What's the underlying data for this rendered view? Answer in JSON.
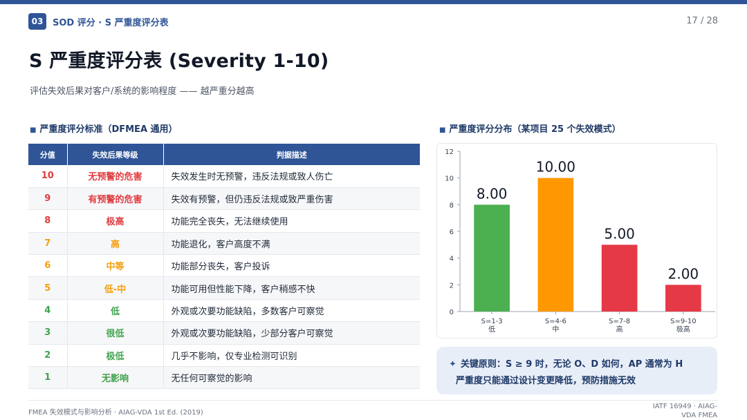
{
  "header": {
    "section_no": "03",
    "section_title": "SOD 评分 · S 严重度评分表",
    "page_indicator": "17 / 28"
  },
  "title": "S 严重度评分表 (Severity 1-10)",
  "subtitle": "评估失效后果对客户/系统的影响程度 —— 越严重分越高",
  "left_panel": {
    "title": "严重度评分标准（DFMEA 通用）",
    "columns": [
      "分值",
      "失效后果等级",
      "判据描述"
    ],
    "rows": [
      {
        "score": "10",
        "level": "无预警的危害",
        "desc": "失效发生时无预警，违反法规或致人伤亡",
        "color": "#e03a3e"
      },
      {
        "score": "9",
        "level": "有预警的危害",
        "desc": "失效有预警，但仍违反法规或致严重伤害",
        "color": "#e03a3e"
      },
      {
        "score": "8",
        "level": "极高",
        "desc": "功能完全丧失，无法继续使用",
        "color": "#e03a3e"
      },
      {
        "score": "7",
        "level": "高",
        "desc": "功能退化，客户高度不满",
        "color": "#f59e0b"
      },
      {
        "score": "6",
        "level": "中等",
        "desc": "功能部分丧失，客户投诉",
        "color": "#f59e0b"
      },
      {
        "score": "5",
        "level": "低-中",
        "desc": "功能可用但性能下降，客户稍感不快",
        "color": "#f59e0b"
      },
      {
        "score": "4",
        "level": "低",
        "desc": "外观或次要功能缺陷，多数客户可察觉",
        "color": "#3fa34d"
      },
      {
        "score": "3",
        "level": "很低",
        "desc": "外观或次要功能缺陷，少部分客户可察觉",
        "color": "#3fa34d"
      },
      {
        "score": "2",
        "level": "极低",
        "desc": "几乎不影响，仅专业检测可识别",
        "color": "#3fa34d"
      },
      {
        "score": "1",
        "level": "无影响",
        "desc": "无任何可察觉的影响",
        "color": "#3fa34d"
      }
    ]
  },
  "right_panel": {
    "title": "严重度评分分布（某项目 25 个失效模式）"
  },
  "chart_data": {
    "type": "bar",
    "categories": [
      "S=1-3\n低",
      "S=4-6\n中",
      "S=7-8\n高",
      "S=9-10\n极高"
    ],
    "values": [
      8,
      10,
      5,
      2
    ],
    "data_labels": [
      "8.00",
      "10.00",
      "5.00",
      "2.00"
    ],
    "colors": [
      "#4caf50",
      "#ff9800",
      "#e63946",
      "#e63946"
    ],
    "ylim": [
      0,
      12
    ],
    "yticks": [
      "0",
      "2",
      "4",
      "6",
      "8",
      "10",
      "12"
    ],
    "grid": false
  },
  "note": {
    "line1": "关键原则：S ≥ 9 时，无论 O、D 如何，AP 通常为 H",
    "line2": "严重度只能通过设计变更降低，预防措施无效",
    "icon": "sparkle-icon"
  },
  "footer": {
    "left": "FMEA 失效模式与影响分析 · AIAG-VDA 1st Ed. (2019)",
    "right_line1": "IATF 16949 · AIAG-",
    "right_line2": "VDA FMEA"
  },
  "colors": {
    "brand": "#2f5597",
    "danger": "#e03a3e",
    "warning": "#f59e0b",
    "success": "#3fa34d"
  }
}
